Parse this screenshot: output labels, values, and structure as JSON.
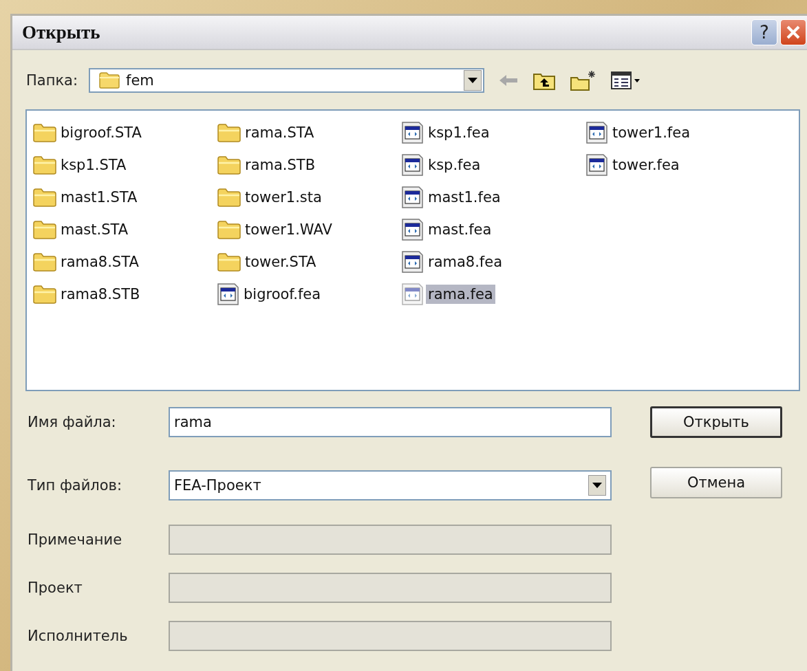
{
  "window": {
    "title": "Открыть",
    "help_button": "?"
  },
  "look_in": {
    "label": "Папка:",
    "value": "fem"
  },
  "files": [
    {
      "name": "bigroof.STA",
      "kind": "folder",
      "selected": false
    },
    {
      "name": "ksp1.STA",
      "kind": "folder",
      "selected": false
    },
    {
      "name": "mast1.STA",
      "kind": "folder",
      "selected": false
    },
    {
      "name": "mast.STA",
      "kind": "folder",
      "selected": false
    },
    {
      "name": "rama8.STA",
      "kind": "folder",
      "selected": false
    },
    {
      "name": "rama8.STB",
      "kind": "folder",
      "selected": false
    },
    {
      "name": "rama.STA",
      "kind": "folder",
      "selected": false
    },
    {
      "name": "rama.STB",
      "kind": "folder",
      "selected": false
    },
    {
      "name": "tower1.sta",
      "kind": "folder",
      "selected": false
    },
    {
      "name": "tower1.WAV",
      "kind": "folder",
      "selected": false
    },
    {
      "name": "tower.STA",
      "kind": "folder",
      "selected": false
    },
    {
      "name": "bigroof.fea",
      "kind": "document",
      "selected": false
    },
    {
      "name": "ksp1.fea",
      "kind": "document",
      "selected": false
    },
    {
      "name": "ksp.fea",
      "kind": "document",
      "selected": false
    },
    {
      "name": "mast1.fea",
      "kind": "document",
      "selected": false
    },
    {
      "name": "mast.fea",
      "kind": "document",
      "selected": false
    },
    {
      "name": "rama8.fea",
      "kind": "document",
      "selected": false
    },
    {
      "name": "rama.fea",
      "kind": "document",
      "selected": true
    },
    {
      "name": "tower1.fea",
      "kind": "document",
      "selected": false
    },
    {
      "name": "tower.fea",
      "kind": "document",
      "selected": false
    }
  ],
  "file_name": {
    "label": "Имя файла:",
    "value": "rama"
  },
  "file_type": {
    "label": "Тип файлов:",
    "value": "FEA-Проект"
  },
  "info_fields": [
    {
      "label": "Примечание",
      "disabled": true
    },
    {
      "label": "Проект",
      "disabled": true
    },
    {
      "label": "Исполнитель",
      "disabled": true
    }
  ],
  "buttons": [
    {
      "label": "Открыть",
      "default": true
    },
    {
      "label": "Отмена",
      "default": false
    }
  ]
}
